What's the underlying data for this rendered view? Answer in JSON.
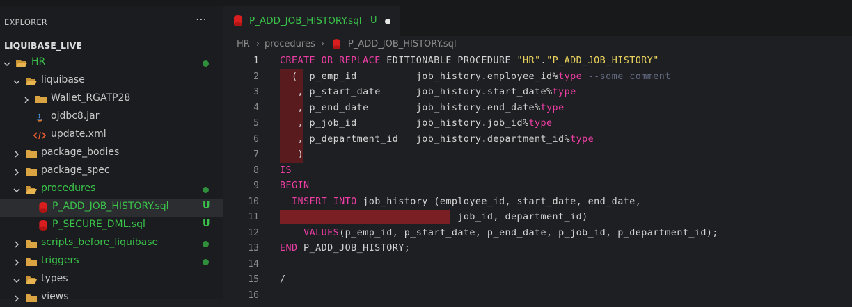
{
  "colors": {
    "accent_green": "#3ac24a",
    "keyword_pink": "#ef3ea6",
    "string_yellow": "#e9d25f",
    "error_red": "#ff4d4d"
  },
  "sidebar": {
    "title": "EXPLORER",
    "more_icon": "ellipsis-icon",
    "workspace": "LIQUIBASE_LIVE",
    "tree": [
      {
        "label": "HR",
        "type": "folder",
        "expanded": true,
        "color": "green-text",
        "status": "dot"
      },
      {
        "label": "liquibase",
        "type": "folder",
        "expanded": true
      },
      {
        "label": "Wallet_RGATP28",
        "type": "folder",
        "expanded": false
      },
      {
        "label": "ojdbc8.jar",
        "type": "file",
        "icon": "java-icon"
      },
      {
        "label": "update.xml",
        "type": "file",
        "icon": "xml-icon"
      },
      {
        "label": "package_bodies",
        "type": "folder",
        "expanded": false
      },
      {
        "label": "package_spec",
        "type": "folder",
        "expanded": false
      },
      {
        "label": "procedures",
        "type": "folder",
        "expanded": true,
        "color": "green-text",
        "status": "dot"
      },
      {
        "label": "P_ADD_JOB_HISTORY.sql",
        "type": "file",
        "icon": "database-icon",
        "status": "U"
      },
      {
        "label": "P_SECURE_DML.sql",
        "type": "file",
        "icon": "database-icon",
        "status": "U"
      },
      {
        "label": "scripts_before_liquibase",
        "type": "folder",
        "expanded": false,
        "status": "dot"
      },
      {
        "label": "triggers",
        "type": "folder",
        "expanded": false,
        "status": "dot"
      },
      {
        "label": "types",
        "type": "folder",
        "expanded": true
      },
      {
        "label": "views",
        "type": "folder",
        "expanded": false
      }
    ]
  },
  "tab": {
    "title": "P_ADD_JOB_HISTORY.sql",
    "status": "U",
    "icon": "database-icon"
  },
  "breadcrumb": [
    "HR",
    "procedures",
    "P_ADD_JOB_HISTORY.sql"
  ],
  "editor": {
    "lines": [
      {
        "n": "1",
        "segs": [
          {
            "t": "CREATE OR REPLACE",
            "c": "kw"
          },
          {
            "t": " EDITIONABLE PROCEDURE ",
            "c": ""
          },
          {
            "t": "\"HR\"",
            "c": "str"
          },
          {
            "t": ".",
            "c": ""
          },
          {
            "t": "\"P_ADD_JOB_HISTORY\"",
            "c": "str"
          }
        ]
      },
      {
        "n": "2",
        "segs": [
          {
            "t": "  (  p_emp_id          job_history.employee_id%",
            "c": ""
          },
          {
            "t": "type",
            "c": "kw"
          },
          {
            "t": " --some comment",
            "c": "com"
          }
        ]
      },
      {
        "n": "3",
        "segs": [
          {
            "t": "   , p_start_date      job_history.start_date%",
            "c": ""
          },
          {
            "t": "type",
            "c": "kw"
          }
        ]
      },
      {
        "n": "4",
        "segs": [
          {
            "t": "   , p_end_date        job_history.end_date%",
            "c": ""
          },
          {
            "t": "type",
            "c": "kw"
          }
        ]
      },
      {
        "n": "5",
        "segs": [
          {
            "t": "   , p_job_id          job_history.job_id%",
            "c": ""
          },
          {
            "t": "type",
            "c": "kw"
          }
        ]
      },
      {
        "n": "6",
        "segs": [
          {
            "t": "   , p_department_id   job_history.department_id%",
            "c": ""
          },
          {
            "t": "type",
            "c": "kw"
          }
        ]
      },
      {
        "n": "7",
        "segs": [
          {
            "t": "   )",
            "c": ""
          }
        ]
      },
      {
        "n": "8",
        "segs": [
          {
            "t": "IS",
            "c": "kw"
          }
        ]
      },
      {
        "n": "9",
        "segs": [
          {
            "t": "BEGIN",
            "c": "kw"
          }
        ]
      },
      {
        "n": "10",
        "segs": [
          {
            "t": "  ",
            "c": ""
          },
          {
            "t": "INSERT INTO",
            "c": "kw"
          },
          {
            "t": " job_history (employee_id, start_date, end_date,",
            "c": ""
          }
        ]
      },
      {
        "n": "11",
        "segs": [
          {
            "t": "                              job_id, department_id)",
            "c": ""
          }
        ]
      },
      {
        "n": "12",
        "segs": [
          {
            "t": "    ",
            "c": ""
          },
          {
            "t": "VALUES",
            "c": "kw"
          },
          {
            "t": "(p_emp_id, p_start_date, p_end_date, p_job_id, p_department_id);",
            "c": ""
          }
        ]
      },
      {
        "n": "13",
        "segs": [
          {
            "t": "END",
            "c": "kw"
          },
          {
            "t": " P_ADD_JOB_HISTORY;",
            "c": ""
          }
        ]
      },
      {
        "n": "14",
        "segs": []
      },
      {
        "n": "15",
        "segs": [
          {
            "t": "/",
            "c": ""
          }
        ]
      },
      {
        "n": "16",
        "segs": []
      }
    ]
  }
}
